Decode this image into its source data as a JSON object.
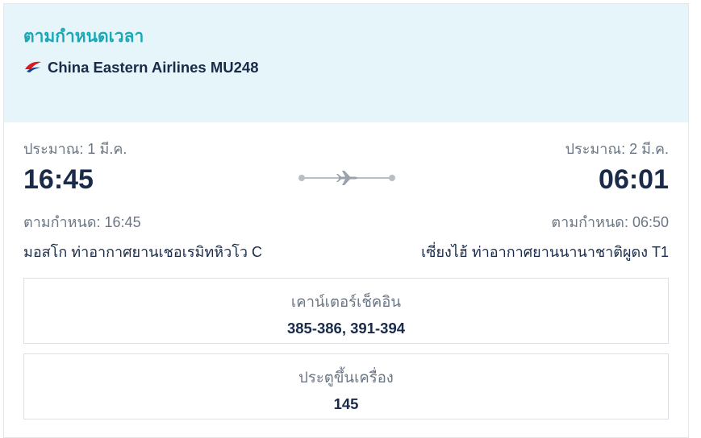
{
  "header": {
    "status": "ตามกำหนดเวลา",
    "airline": "China Eastern Airlines MU248",
    "logo_icon": "china-eastern-swallow-logo",
    "accent_color": "#1aa7b8",
    "logo_color": "#d71920",
    "background_color": "#e6f5f9"
  },
  "departure": {
    "estimate": "ประมาณ: 1 มี.ค.",
    "time": "16:45",
    "scheduled": "ตามกำหนด: 16:45",
    "airport": "มอสโก ท่าอากาศยานเชอเรมิทหิวโว C"
  },
  "arrival": {
    "estimate": "ประมาณ: 2 มี.ค.",
    "time": "06:01",
    "scheduled": "ตามกำหนด: 06:50",
    "airport": "เซี่ยงไฮ้ ท่าอากาศยานนานาชาติผูดง T1"
  },
  "route_icon": "airplane-icon",
  "checkin": {
    "title": "เคาน์เตอร์เช็คอิน",
    "value": "385-386, 391-394"
  },
  "gate": {
    "title": "ประตูขึ้นเครื่อง",
    "value": "145"
  }
}
